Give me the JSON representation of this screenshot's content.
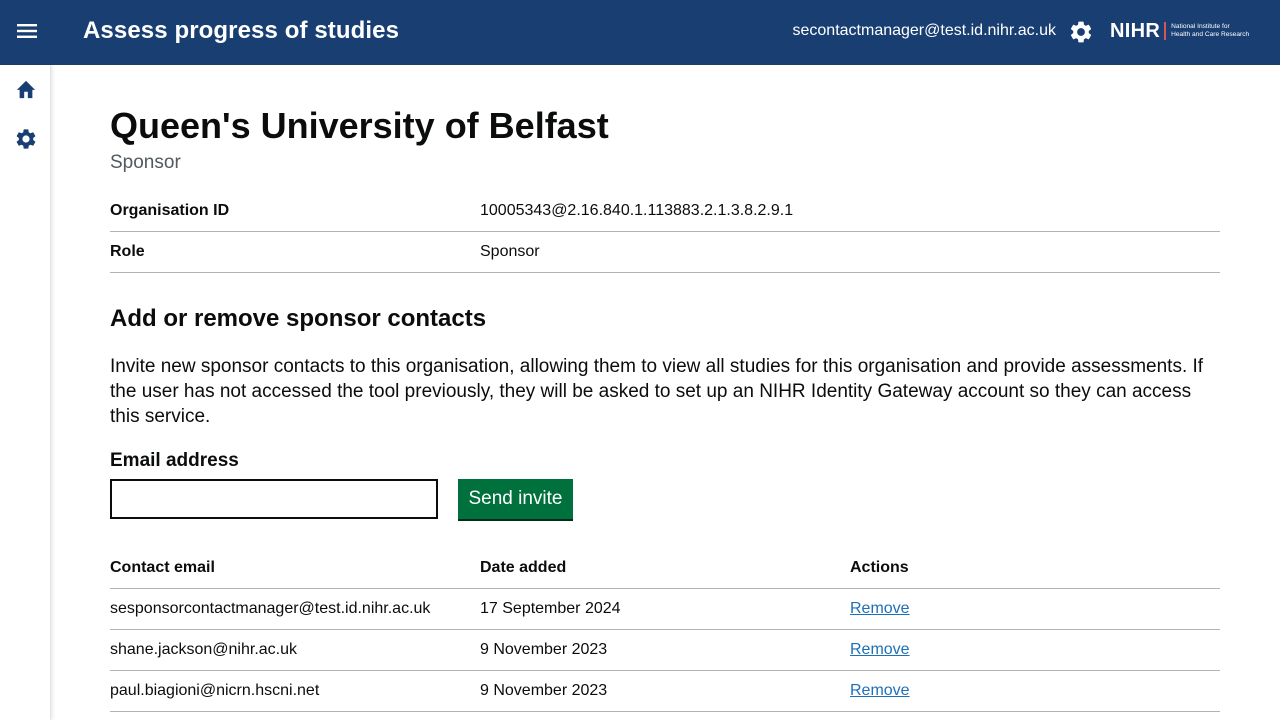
{
  "header": {
    "title": "Assess progress of studies",
    "user_email": "secontactmanager@test.id.nihr.ac.uk",
    "logo": {
      "wordmark": "NIHR",
      "sub_line1": "National Institute for",
      "sub_line2": "Health and Care Research"
    },
    "icons": {
      "menu": "menu-icon",
      "settings": "gear-icon"
    },
    "colors": {
      "background": "#193e72",
      "logo_bar": "#d6545c"
    }
  },
  "sidebar": {
    "items": [
      {
        "icon": "home-icon"
      },
      {
        "icon": "gear-icon"
      }
    ]
  },
  "organisation": {
    "name": "Queen's University of Belfast",
    "caption": "Sponsor",
    "summary": [
      {
        "key": "Organisation ID",
        "value": "10005343@2.16.840.1.113883.2.1.3.8.2.9.1"
      },
      {
        "key": "Role",
        "value": "Sponsor"
      }
    ]
  },
  "contacts_section": {
    "heading": "Add or remove sponsor contacts",
    "description": "Invite new sponsor contacts to this organisation, allowing them to view all studies for this organisation and provide assessments. If the user has not accessed the tool previously, they will be asked to set up an NIHR Identity Gateway account so they can access this service.",
    "email_label": "Email address",
    "email_value": "",
    "invite_button": "Send invite",
    "colors": {
      "invite_button": "#00703c",
      "link": "#1d70b8"
    }
  },
  "contacts_table": {
    "headers": [
      "Contact email",
      "Date added",
      "Actions"
    ],
    "rows": [
      {
        "email": "sesponsorcontactmanager@test.id.nihr.ac.uk",
        "date": "17 September 2024",
        "action": "Remove"
      },
      {
        "email": "shane.jackson@nihr.ac.uk",
        "date": "9 November 2023",
        "action": "Remove"
      },
      {
        "email": "paul.biagioni@nicrn.hscni.net",
        "date": "9 November 2023",
        "action": "Remove"
      }
    ]
  }
}
